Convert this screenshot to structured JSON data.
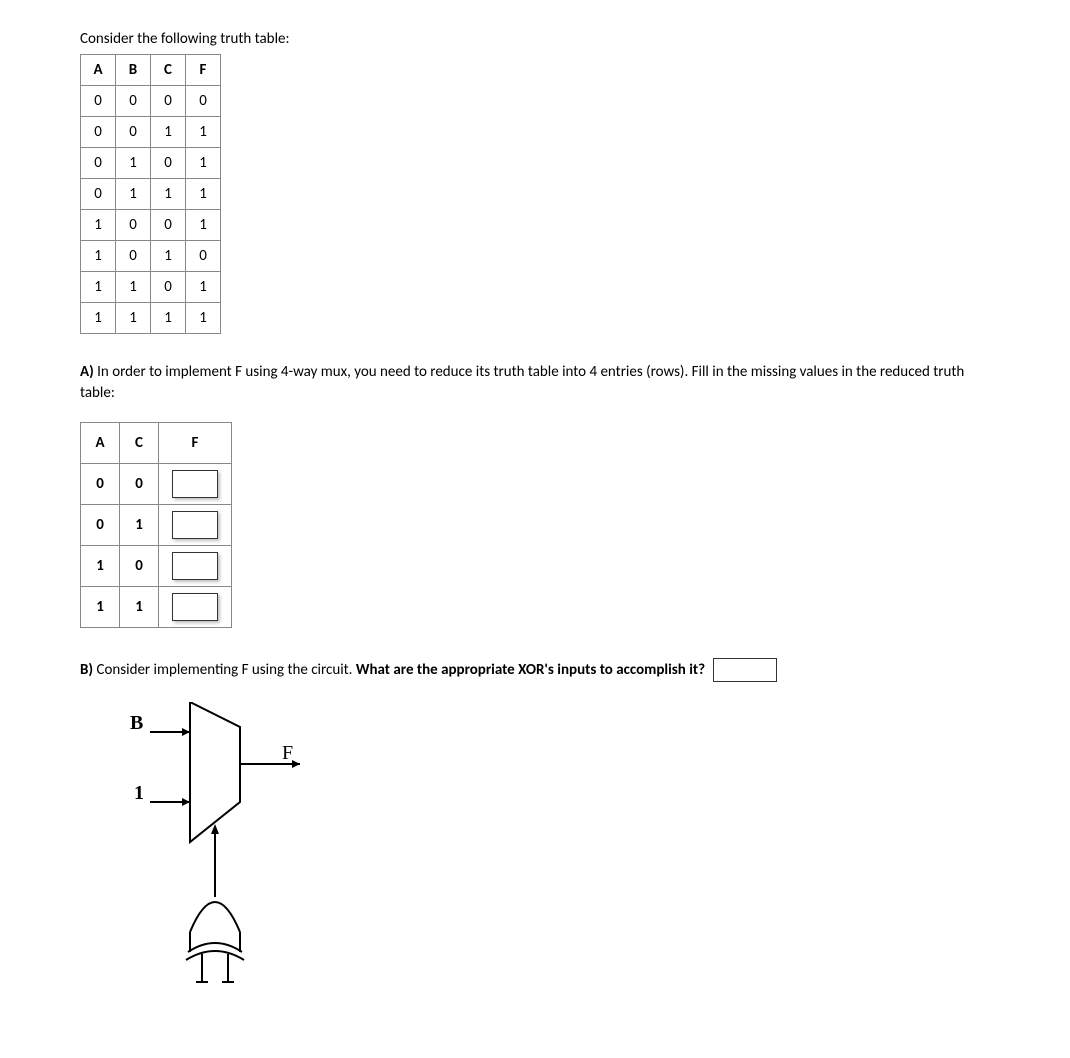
{
  "intro_text": "Consider the following truth table:",
  "truth_table": {
    "headers": [
      "A",
      "B",
      "C",
      "F"
    ],
    "rows": [
      [
        "0",
        "0",
        "0",
        "0"
      ],
      [
        "0",
        "0",
        "1",
        "1"
      ],
      [
        "0",
        "1",
        "0",
        "1"
      ],
      [
        "0",
        "1",
        "1",
        "1"
      ],
      [
        "1",
        "0",
        "0",
        "1"
      ],
      [
        "1",
        "0",
        "1",
        "0"
      ],
      [
        "1",
        "1",
        "0",
        "1"
      ],
      [
        "1",
        "1",
        "1",
        "1"
      ]
    ]
  },
  "partA": {
    "label": "A)",
    "text": " In order to implement F using 4-way mux, you need to reduce its truth table into 4 entries (rows). Fill in the missing values in the reduced truth table:"
  },
  "reduced_table": {
    "headers": [
      "A",
      "C",
      "F"
    ],
    "rows": [
      [
        "0",
        "0"
      ],
      [
        "0",
        "1"
      ],
      [
        "1",
        "0"
      ],
      [
        "1",
        "1"
      ]
    ]
  },
  "partB": {
    "label": "B)",
    "text_before_bold": " Consider implementing  F using the circuit. ",
    "text_bold": "What are the appropriate XOR's inputs to accomplish it?"
  },
  "circuit_labels": {
    "input_top": "B",
    "input_bottom": "1",
    "output": "F"
  }
}
